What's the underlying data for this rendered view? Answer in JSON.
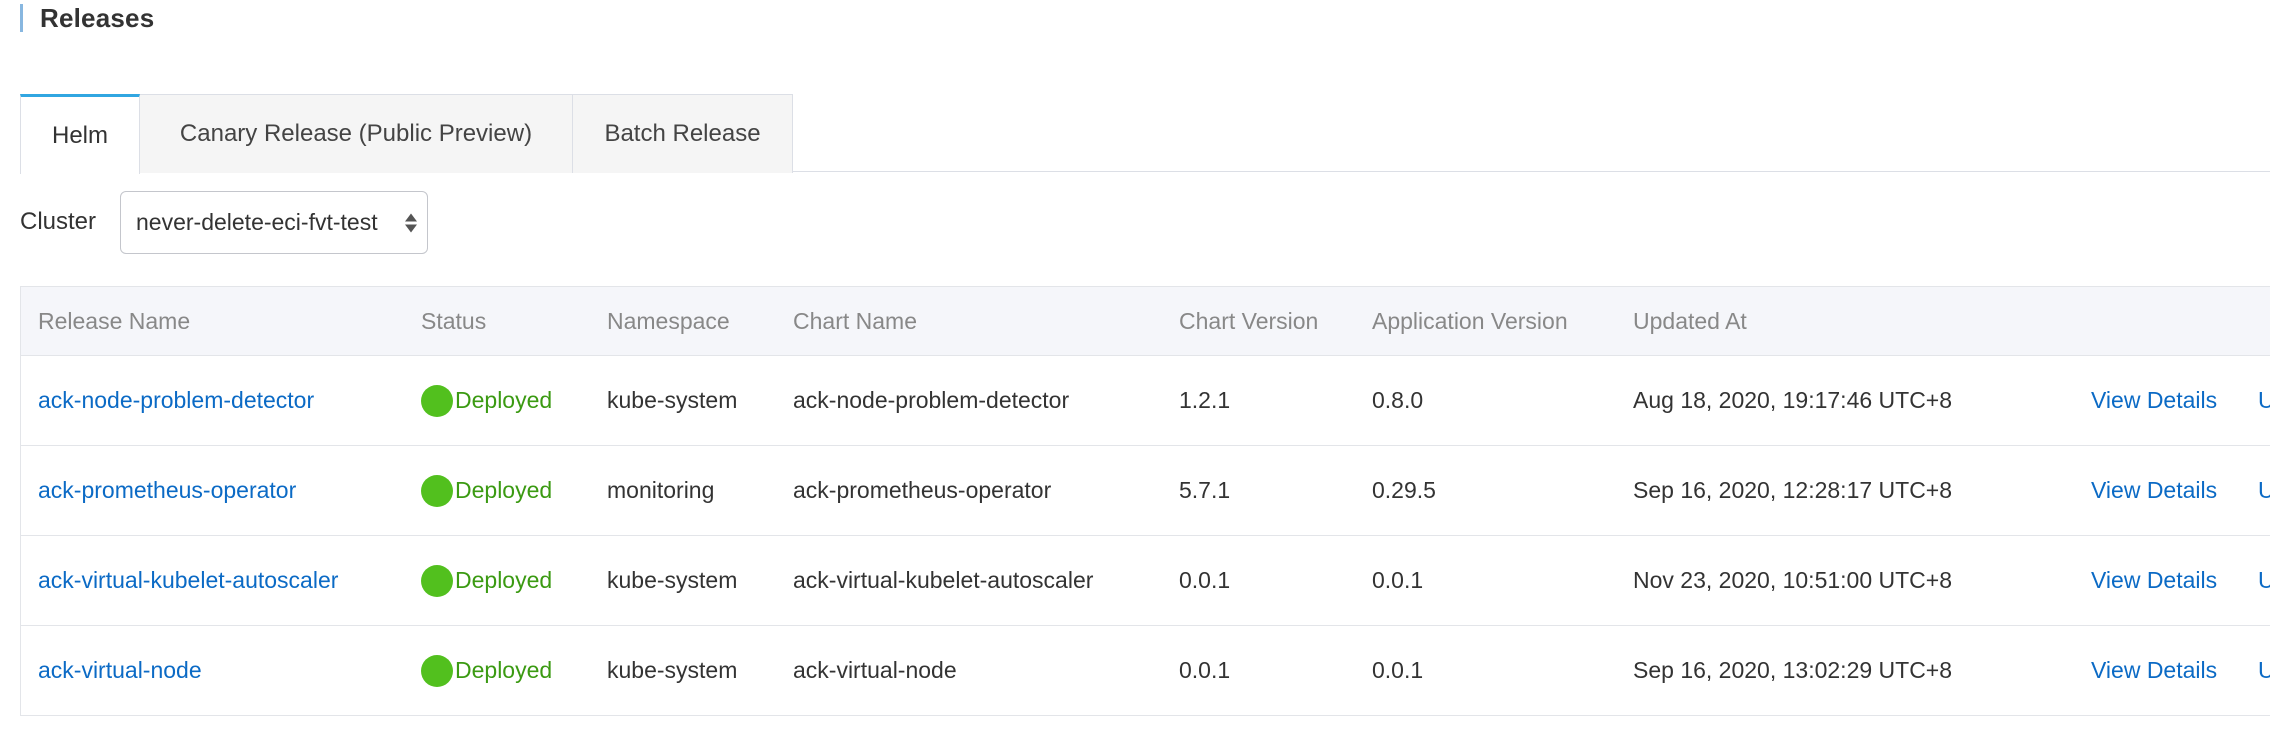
{
  "page": {
    "title": "Releases"
  },
  "tabs": [
    {
      "label": "Helm",
      "active": true
    },
    {
      "label": "Canary Release (Public Preview)",
      "active": false
    },
    {
      "label": "Batch Release",
      "active": false
    }
  ],
  "cluster": {
    "label": "Cluster",
    "selected": "never-delete-eci-fvt-test"
  },
  "table": {
    "columns": [
      "Release Name",
      "Status",
      "Namespace",
      "Chart Name",
      "Chart Version",
      "Application Version",
      "Updated At"
    ],
    "rows": [
      {
        "release_name": "ack-node-problem-detector",
        "status": "Deployed",
        "namespace": "kube-system",
        "chart_name": "ack-node-problem-detector",
        "chart_version": "1.2.1",
        "app_version": "0.8.0",
        "updated_at": "Aug 18, 2020, 19:17:46 UTC+8",
        "action": "View Details",
        "action2": "U"
      },
      {
        "release_name": "ack-prometheus-operator",
        "status": "Deployed",
        "namespace": "monitoring",
        "chart_name": "ack-prometheus-operator",
        "chart_version": "5.7.1",
        "app_version": "0.29.5",
        "updated_at": "Sep 16, 2020, 12:28:17 UTC+8",
        "action": "View Details",
        "action2": "U"
      },
      {
        "release_name": "ack-virtual-kubelet-autoscaler",
        "status": "Deployed",
        "namespace": "kube-system",
        "chart_name": "ack-virtual-kubelet-autoscaler",
        "chart_version": "0.0.1",
        "app_version": "0.0.1",
        "updated_at": "Nov 23, 2020, 10:51:00 UTC+8",
        "action": "View Details",
        "action2": "U"
      },
      {
        "release_name": "ack-virtual-node",
        "status": "Deployed",
        "namespace": "kube-system",
        "chart_name": "ack-virtual-node",
        "chart_version": "0.0.1",
        "app_version": "0.0.1",
        "updated_at": "Sep 16, 2020, 13:02:29 UTC+8",
        "action": "View Details",
        "action2": "U"
      }
    ]
  },
  "colors": {
    "accent": "#31a6e1",
    "link": "#0b6ac5",
    "status_deployed": "#52c01e",
    "status_text": "#3b9a12"
  },
  "icons": {
    "status_dot": "status-dot-icon",
    "select_arrows": "select-arrows-icon"
  }
}
